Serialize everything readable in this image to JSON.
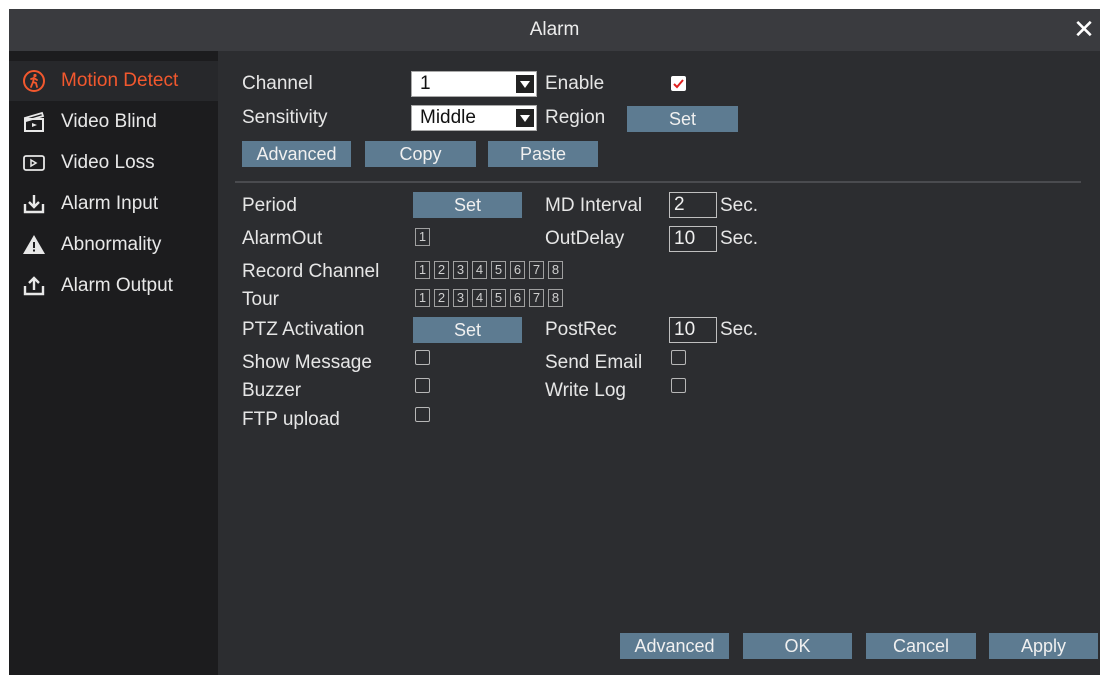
{
  "window": {
    "title": "Alarm"
  },
  "sidebar": {
    "items": [
      {
        "label": "Motion Detect",
        "icon": "motion-run-icon",
        "active": true
      },
      {
        "label": "Video Blind",
        "icon": "clapperboard-icon"
      },
      {
        "label": "Video Loss",
        "icon": "video-screen-icon"
      },
      {
        "label": "Alarm Input",
        "icon": "alarm-input-icon"
      },
      {
        "label": "Abnormality",
        "icon": "warning-icon"
      },
      {
        "label": "Alarm Output",
        "icon": "alarm-output-icon"
      }
    ]
  },
  "form": {
    "channel_label": "Channel",
    "channel_value": "1",
    "enable_label": "Enable",
    "enable_checked": true,
    "sensitivity_label": "Sensitivity",
    "sensitivity_value": "Middle",
    "region_label": "Region",
    "region_button": "Set",
    "advanced_button": "Advanced",
    "copy_button": "Copy",
    "paste_button": "Paste",
    "period_label": "Period",
    "period_button": "Set",
    "md_interval_label": "MD Interval",
    "md_interval_value": "2",
    "md_interval_unit": "Sec.",
    "alarmout_label": "AlarmOut",
    "alarmout_boxes": [
      "1"
    ],
    "outdelay_label": "OutDelay",
    "outdelay_value": "10",
    "outdelay_unit": "Sec.",
    "record_channel_label": "Record Channel",
    "record_channels": [
      "1",
      "2",
      "3",
      "4",
      "5",
      "6",
      "7",
      "8"
    ],
    "tour_label": "Tour",
    "tour_channels": [
      "1",
      "2",
      "3",
      "4",
      "5",
      "6",
      "7",
      "8"
    ],
    "ptz_label": "PTZ Activation",
    "ptz_button": "Set",
    "postrec_label": "PostRec",
    "postrec_value": "10",
    "postrec_unit": "Sec.",
    "show_message_label": "Show Message",
    "send_email_label": "Send Email",
    "buzzer_label": "Buzzer",
    "write_log_label": "Write Log",
    "ftp_upload_label": "FTP upload"
  },
  "footer": {
    "advanced": "Advanced",
    "ok": "OK",
    "cancel": "Cancel",
    "apply": "Apply"
  },
  "colors": {
    "accent": "#f2582e",
    "button": "#5d7b91",
    "panel": "#2c2d30",
    "sidebar": "#1c1c1e"
  }
}
